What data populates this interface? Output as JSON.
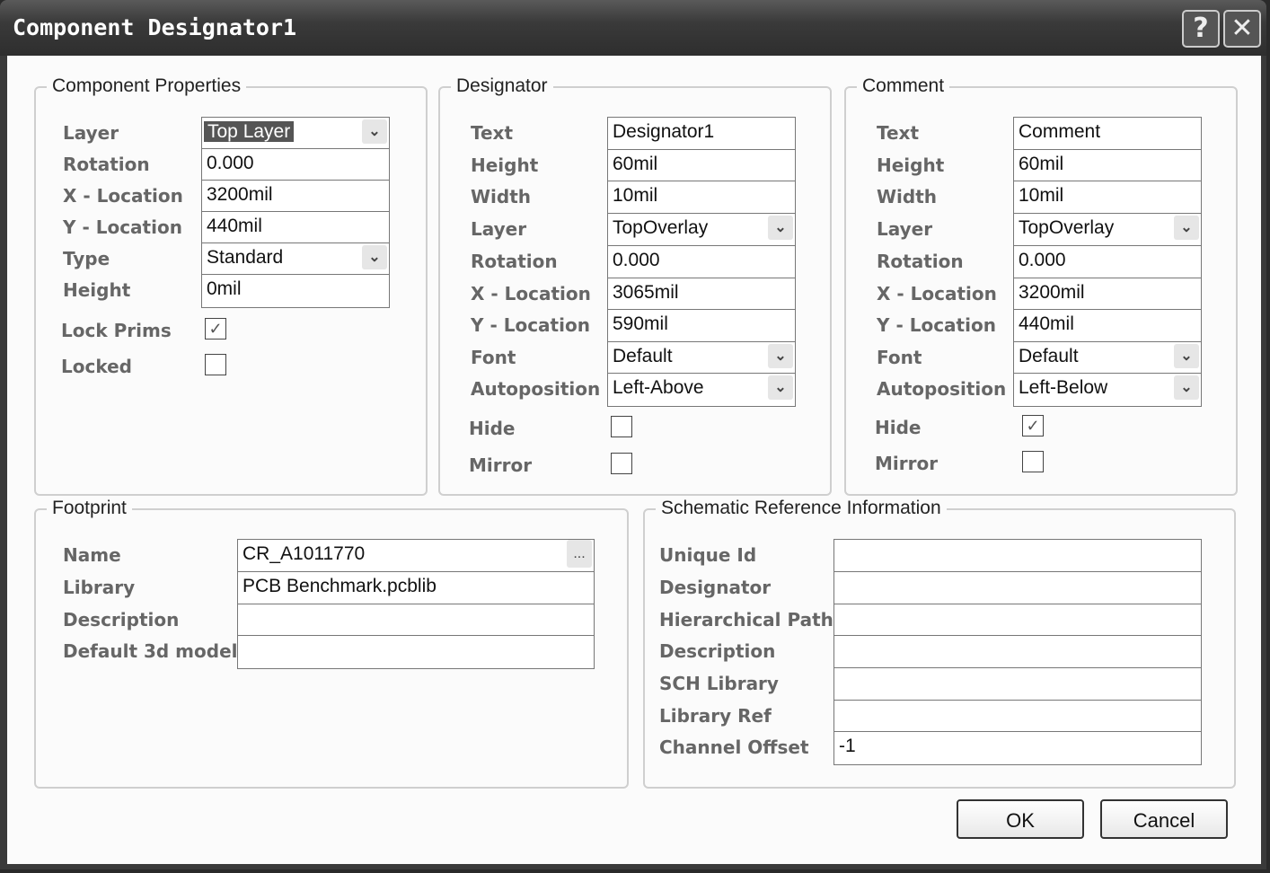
{
  "window": {
    "title": "Component Designator1",
    "help_label": "?",
    "close_label": "✕"
  },
  "component_properties": {
    "title": "Component Properties",
    "rows": [
      {
        "label": "Layer",
        "value": "Top Layer",
        "kind": "select",
        "focused": true
      },
      {
        "label": "Rotation",
        "value": " 0.000",
        "kind": "text"
      },
      {
        "label": "X - Location",
        "value": "3200mil",
        "kind": "text"
      },
      {
        "label": "Y - Location",
        "value": "440mil",
        "kind": "text"
      },
      {
        "label": "Type",
        "value": "Standard",
        "kind": "select"
      },
      {
        "label": "Height",
        "value": "0mil",
        "kind": "text"
      }
    ],
    "checks": [
      {
        "label": "Lock Prims",
        "checked": true
      },
      {
        "label": "Locked",
        "checked": false
      }
    ]
  },
  "designator": {
    "title": "Designator",
    "rows": [
      {
        "label": "Text",
        "value": "Designator1",
        "kind": "text"
      },
      {
        "label": "Height",
        "value": "60mil",
        "kind": "text"
      },
      {
        "label": "Width",
        "value": "10mil",
        "kind": "text"
      },
      {
        "label": "Layer",
        "value": "TopOverlay",
        "kind": "select"
      },
      {
        "label": "Rotation",
        "value": " 0.000",
        "kind": "text"
      },
      {
        "label": "X - Location",
        "value": "3065mil",
        "kind": "text"
      },
      {
        "label": "Y - Location",
        "value": "590mil",
        "kind": "text"
      },
      {
        "label": "Font",
        "value": "Default",
        "kind": "select"
      },
      {
        "label": "Autoposition",
        "value": "Left-Above",
        "kind": "select"
      }
    ],
    "checks": [
      {
        "label": "Hide",
        "checked": false
      },
      {
        "label": "Mirror",
        "checked": false
      }
    ]
  },
  "comment": {
    "title": "Comment",
    "rows": [
      {
        "label": "Text",
        "value": "Comment",
        "kind": "text"
      },
      {
        "label": "Height",
        "value": "60mil",
        "kind": "text"
      },
      {
        "label": "Width",
        "value": "10mil",
        "kind": "text"
      },
      {
        "label": "Layer",
        "value": "TopOverlay",
        "kind": "select"
      },
      {
        "label": "Rotation",
        "value": " 0.000",
        "kind": "text"
      },
      {
        "label": "X - Location",
        "value": "3200mil",
        "kind": "text"
      },
      {
        "label": "Y - Location",
        "value": "440mil",
        "kind": "text"
      },
      {
        "label": "Font",
        "value": "Default",
        "kind": "select"
      },
      {
        "label": "Autoposition",
        "value": "Left-Below",
        "kind": "select"
      }
    ],
    "checks": [
      {
        "label": "Hide",
        "checked": true
      },
      {
        "label": "Mirror",
        "checked": false
      }
    ]
  },
  "footprint": {
    "title": "Footprint",
    "browse_label": "...",
    "rows": [
      {
        "label": "Name",
        "value": "CR_A1011770",
        "kind": "browse"
      },
      {
        "label": "Library",
        "value": "PCB Benchmark.pcblib",
        "kind": "text"
      },
      {
        "label": "Description",
        "value": "",
        "kind": "text"
      },
      {
        "label": "Default 3d model",
        "value": "",
        "kind": "text"
      }
    ]
  },
  "schematic": {
    "title": "Schematic Reference Information",
    "rows": [
      {
        "label": "Unique Id",
        "value": "",
        "kind": "text"
      },
      {
        "label": "Designator",
        "value": "",
        "kind": "text"
      },
      {
        "label": "Hierarchical Path",
        "value": "",
        "kind": "text"
      },
      {
        "label": "Description",
        "value": "",
        "kind": "text"
      },
      {
        "label": "SCH Library",
        "value": "",
        "kind": "text"
      },
      {
        "label": "Library Ref",
        "value": "",
        "kind": "text"
      },
      {
        "label": "Channel Offset",
        "value": "-1",
        "kind": "text"
      }
    ]
  },
  "buttons": {
    "ok": "OK",
    "cancel": "Cancel"
  }
}
